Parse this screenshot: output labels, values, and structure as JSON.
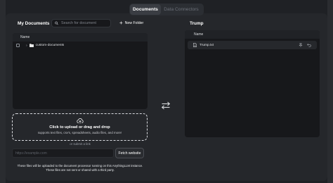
{
  "tabs": [
    {
      "label": "Documents",
      "active": true
    },
    {
      "label": "Data Connectors",
      "active": false
    }
  ],
  "my_documents": {
    "title": "My Documents",
    "search_placeholder": "Search for document",
    "new_folder_label": "New Folder",
    "column_header": "Name",
    "items": [
      {
        "name": "custom-documents",
        "type": "folder",
        "expanded": false
      }
    ]
  },
  "workspace": {
    "title": "Trump",
    "column_header": "Name",
    "items": [
      {
        "name": "Trump.txt",
        "type": "file"
      }
    ]
  },
  "upload": {
    "title": "Click to upload or drag and drop",
    "subtitle": "supports text files, csv's, spreadsheets, audio files, and more!",
    "or_link": "or submit a link",
    "url_placeholder": "https://example.com",
    "fetch_label": "Fetch website"
  },
  "notice": {
    "line1": "These files will be uploaded to the document processor running on this AnythingLLM instance.",
    "line2": "These files are not sent or shared with a third party."
  },
  "icons": {
    "search": "search-icon",
    "folder": "folder-icon",
    "file": "file-icon",
    "pin": "pin-icon",
    "undo": "undo-icon",
    "swap": "swap-arrows-icon",
    "upload": "cloud-upload-icon"
  },
  "colors": {
    "background": "#25272b",
    "panel": "#17181b",
    "text": "#ffffff"
  }
}
